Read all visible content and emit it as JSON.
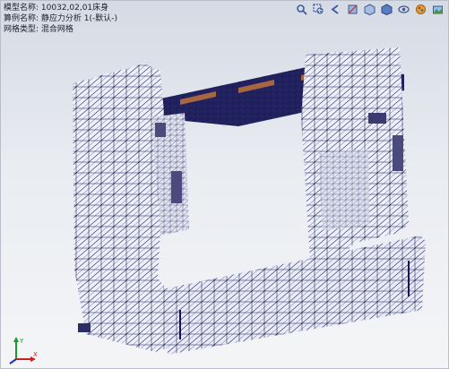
{
  "info": {
    "model_name": "模型名称: 10032,02,01床身",
    "study_name": "算例名称: 静应力分析 1(-默认-)",
    "mesh_type": "网格类型: 混合网格"
  },
  "hud_icons": [
    "search-icon",
    "zoom-area-icon",
    "previous-view-icon",
    "section-view-icon",
    "view-orientation-icon",
    "display-style-icon",
    "hide-show-icon",
    "edit-appearance-icon",
    "scene-icon"
  ],
  "colors": {
    "mesh_line": "#14145a",
    "part_fill": "#eef0f7",
    "rail_top": "#20205e",
    "highlight": "#c8783a"
  },
  "triad": {
    "y_label": "Y",
    "x_label": "X"
  }
}
